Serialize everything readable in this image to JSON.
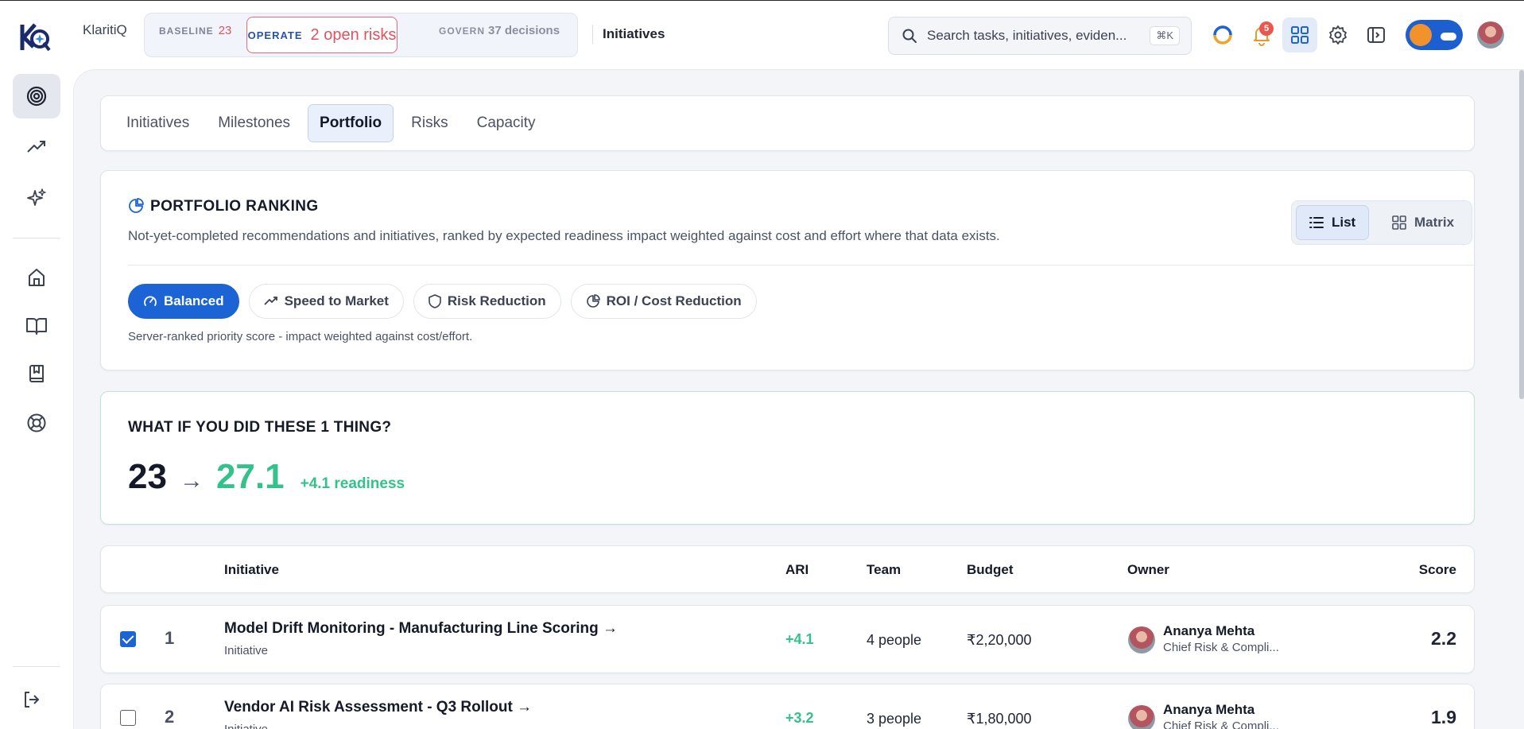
{
  "brand": {
    "name": "KlaritiQ"
  },
  "phases": {
    "baseline": {
      "label": "BASELINE",
      "value": "23"
    },
    "operate": {
      "label": "OPERATE",
      "value": "2 open risks"
    },
    "govern": {
      "label": "GOVERN",
      "value": "37 decisions"
    }
  },
  "page_context": "Initiatives",
  "search": {
    "placeholder": "Search tasks, initiatives, eviden...",
    "shortcut": "⌘K"
  },
  "notifications": {
    "count": "5"
  },
  "colors": {
    "accent": "#1c63d6",
    "positive": "#33c28b",
    "alert": "#e0525f"
  },
  "sidebar": {
    "items": [
      {
        "icon": "target-icon",
        "active": true
      },
      {
        "icon": "trending-up-icon"
      },
      {
        "icon": "sparkles-icon"
      },
      {
        "icon": "home-icon"
      },
      {
        "icon": "book-open-icon"
      },
      {
        "icon": "bookmark-book-icon"
      },
      {
        "icon": "lifebuoy-icon"
      },
      {
        "icon": "logout-icon"
      }
    ]
  },
  "tabs": [
    {
      "label": "Initiatives"
    },
    {
      "label": "Milestones"
    },
    {
      "label": "Portfolio",
      "active": true
    },
    {
      "label": "Risks"
    },
    {
      "label": "Capacity"
    }
  ],
  "ranking": {
    "title": "PORTFOLIO RANKING",
    "description": "Not-yet-completed recommendations and initiatives, ranked by expected readiness impact weighted against cost and effort where that data exists.",
    "views": {
      "list": "List",
      "matrix": "Matrix",
      "selected": "List"
    },
    "strategies": [
      {
        "label": "Balanced",
        "icon": "gauge-icon",
        "active": true
      },
      {
        "label": "Speed to Market",
        "icon": "trending-up-icon"
      },
      {
        "label": "Risk Reduction",
        "icon": "shield-icon"
      },
      {
        "label": "ROI / Cost Reduction",
        "icon": "pie-chart-icon"
      }
    ],
    "note": "Server-ranked priority score - impact weighted against cost/effort."
  },
  "whatif": {
    "title": "WHAT IF YOU DID THESE 1 THING?",
    "from": "23",
    "arrow": "→",
    "to": "27.1",
    "delta": "+4.1 readiness"
  },
  "table": {
    "columns": {
      "initiative": "Initiative",
      "ari": "ARI",
      "team": "Team",
      "budget": "Budget",
      "owner": "Owner",
      "score": "Score"
    },
    "rows": [
      {
        "checked": true,
        "rank": "1",
        "name": "Model Drift Monitoring - Manufacturing Line Scoring →",
        "type": "Initiative",
        "ari": "+4.1",
        "team": "4 people",
        "budget": "₹2,20,000",
        "owner": "Ananya Mehta",
        "role": "Chief Risk & Compli...",
        "score": "2.2"
      },
      {
        "checked": false,
        "rank": "2",
        "name": "Vendor AI Risk Assessment - Q3 Rollout →",
        "type": "Initiative",
        "ari": "+3.2",
        "team": "3 people",
        "budget": "₹1,80,000",
        "owner": "Ananya Mehta",
        "role": "Chief Risk & Compli...",
        "score": "1.9"
      }
    ]
  }
}
